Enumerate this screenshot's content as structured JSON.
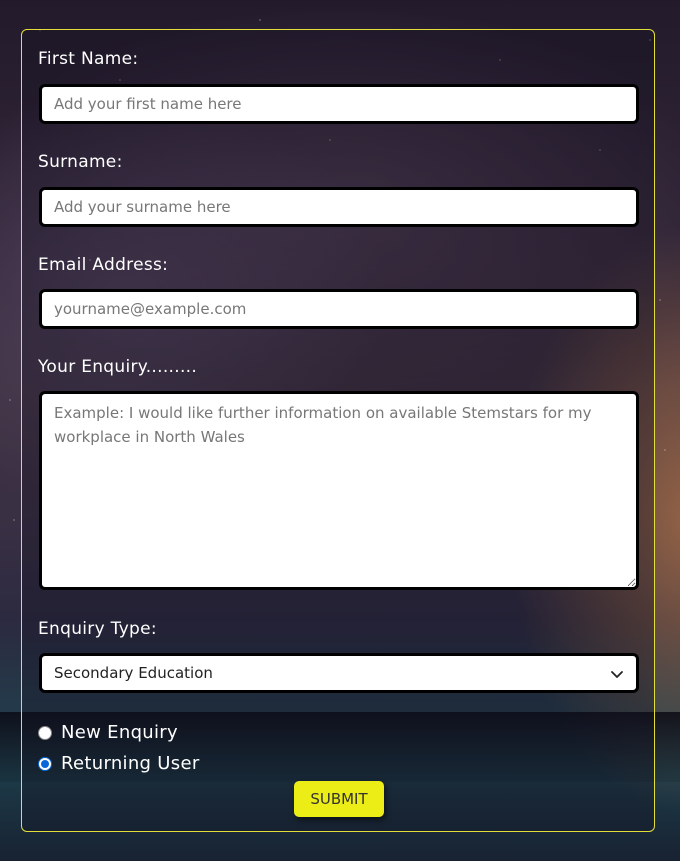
{
  "form": {
    "first_name": {
      "label": "First Name:",
      "placeholder": "Add your first name here"
    },
    "surname": {
      "label": "Surname:",
      "placeholder": "Add your surname here"
    },
    "email": {
      "label": "Email Address:",
      "placeholder": "yourname@example.com"
    },
    "enquiry": {
      "label": "Your Enquiry.........",
      "placeholder": "Example: I would like further information on available Stemstars for my workplace in North Wales"
    },
    "enquiry_type": {
      "label": "Enquiry Type:",
      "selected": "Secondary Education"
    },
    "radios": [
      {
        "label": "New Enquiry",
        "checked": false
      },
      {
        "label": "Returning User",
        "checked": true
      }
    ],
    "submit_label": "SUBMIT"
  },
  "colors": {
    "card_border": "#e3df3a",
    "submit_bg": "#ecec17",
    "radio_checked": "#0a66d8"
  },
  "icons": {
    "select_arrow": "chevron-down-icon"
  }
}
